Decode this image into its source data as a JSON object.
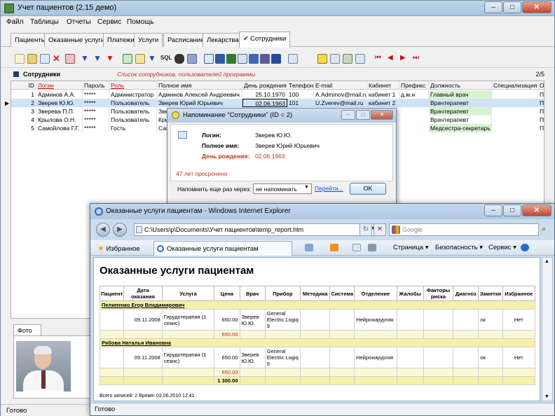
{
  "app": {
    "title": "Учет пациентов (2.15 демо)",
    "window_buttons": [
      "–",
      "□",
      "✕"
    ]
  },
  "menu": [
    "Файл",
    "Таблицы",
    "Отчеты",
    "Сервис",
    "Помощь"
  ],
  "tabs": [
    "Пациенты",
    "Оказанные услуги",
    "Платежи",
    "Услуги",
    "Расписание",
    "Лекарства",
    "Сотрудники"
  ],
  "active_tab": "Сотрудники",
  "toolbar": {
    "icons": [
      "new-icon",
      "edit-icon",
      "copy-icon",
      "delete-icon",
      "delete-all-icon",
      "filter-icon",
      "clear-filter-icon",
      "filter-off-icon",
      "refresh-icon",
      "find-icon",
      "find-next-icon",
      "sql-icon",
      "binoculars-icon",
      "group-icon",
      "word-icon",
      "excel-icon",
      "html-icon",
      "report-icon",
      "print-icon",
      "preview-icon",
      "calendar-icon",
      "reminder-icon",
      "settings-icon",
      "tools-icon",
      "list-icon",
      "first-icon",
      "prev-icon",
      "next-icon",
      "last-icon"
    ],
    "sql_label": "SQL"
  },
  "grid": {
    "title": "Сотрудники",
    "subtitle": "Список сотрудников, пользователей программы",
    "count": "2/5",
    "columns": [
      "ID",
      "Логин",
      "Пароль",
      "Роль",
      "Полное имя",
      "День рождения",
      "Телефон",
      "E-mail",
      "Кабинет",
      "Префикс",
      "Должность",
      "Специализация",
      "О"
    ],
    "rows": [
      [
        "1",
        "Админов А.А.",
        "*****",
        "Администратор",
        "Админов Алексей Андреевич",
        "25.10.1970",
        "100",
        "A.Adminov@mail.ru",
        "кабинет 1",
        "д.м.н",
        "Главный врач",
        "",
        "П"
      ],
      [
        "2",
        "Зверев Ю.Ю.",
        "*****",
        "Пользователь",
        "Зверев Юрий Юрьевич",
        "02.06.1963",
        "101",
        "U.Zverev@mail.ru",
        "кабинет 2",
        "",
        "Врачтерапевт",
        "",
        "П"
      ],
      [
        "3",
        "Зверева П.П.",
        "*****",
        "Пользователь",
        "Зве",
        "",
        "",
        "",
        "",
        "",
        "Врачтерапевт",
        "",
        "П"
      ],
      [
        "4",
        "Крылова О.Н.",
        "*****",
        "Пользователь",
        "Кры",
        "",
        "",
        "",
        "",
        "",
        "Врачтерапевт",
        "",
        "П"
      ],
      [
        "5",
        "Самойлова Г.Г.",
        "*****",
        "Гость",
        "Сам",
        "",
        "",
        "",
        "",
        "",
        "Медсестра-секретарь",
        "",
        "П"
      ]
    ],
    "selected_row": 2
  },
  "photo": {
    "tab_label": "Фото"
  },
  "status_main": "Готово",
  "reminder": {
    "title": "Напоминание \"Сотрудники\" (ID = 2)",
    "fields": [
      {
        "label": "Логин:",
        "value": "Зверев Ю.Ю."
      },
      {
        "label": "Полное имя:",
        "value": "Зверев Юрий Юрьевич"
      },
      {
        "label": "День рождения:",
        "value": "02.06.1963"
      }
    ],
    "overdue": "47 лет просрочено",
    "remind_label": "Напомнить еще раз через:",
    "remind_value": "не напоминать",
    "link": "Перейти...",
    "ok": "OK"
  },
  "ie": {
    "title": "Оказанные услуги пациентам - Windows Internet Explorer",
    "address": "C:\\Users\\p\\Documents\\Учет пациентов\\temp_report.htm",
    "search_placeholder": "Google",
    "favorites": "Избранное",
    "tab": "Оказанные услуги пациентам",
    "commands": [
      "Страница ▾",
      "Безопасность ▾",
      "Сервис ▾"
    ],
    "status": "Готово",
    "report": {
      "title": "Оказанные услуги пациентам",
      "headers": [
        "Пациент",
        "Дата оказания",
        "Услуга",
        "Цена",
        "Врач",
        "Прибор",
        "Методика",
        "Система",
        "Отделение",
        "Жалобы",
        "Факторы риска",
        "Диагноз",
        "Заметки",
        "Избранное"
      ],
      "groups": [
        {
          "patient": "Пелипенко Егор Владимирович",
          "row": [
            "",
            "09.11.2008",
            "Гирудотерапия (1 сеанс)",
            "650.00",
            "Зверев Ю.Ю.",
            "General Electric Logiq 9",
            "",
            "",
            "Нейрохирургия",
            "",
            "",
            "",
            "ок",
            "Нет"
          ],
          "subtotal": "650.00"
        },
        {
          "patient": "Рябова Наталья Ивановна",
          "row": [
            "",
            "09.11.2008",
            "Гирудотерапия (1 сеанс)",
            "650.00",
            "Зверев Ю.Ю.",
            "General Electric Logiq 9",
            "",
            "",
            "Нейрохирургия",
            "",
            "",
            "",
            "ок",
            "Нет"
          ],
          "subtotal": "650.00"
        }
      ],
      "total": "1 300.00",
      "footer": "Всего записей:  2    Время:  02.06.2010 12:41"
    }
  }
}
